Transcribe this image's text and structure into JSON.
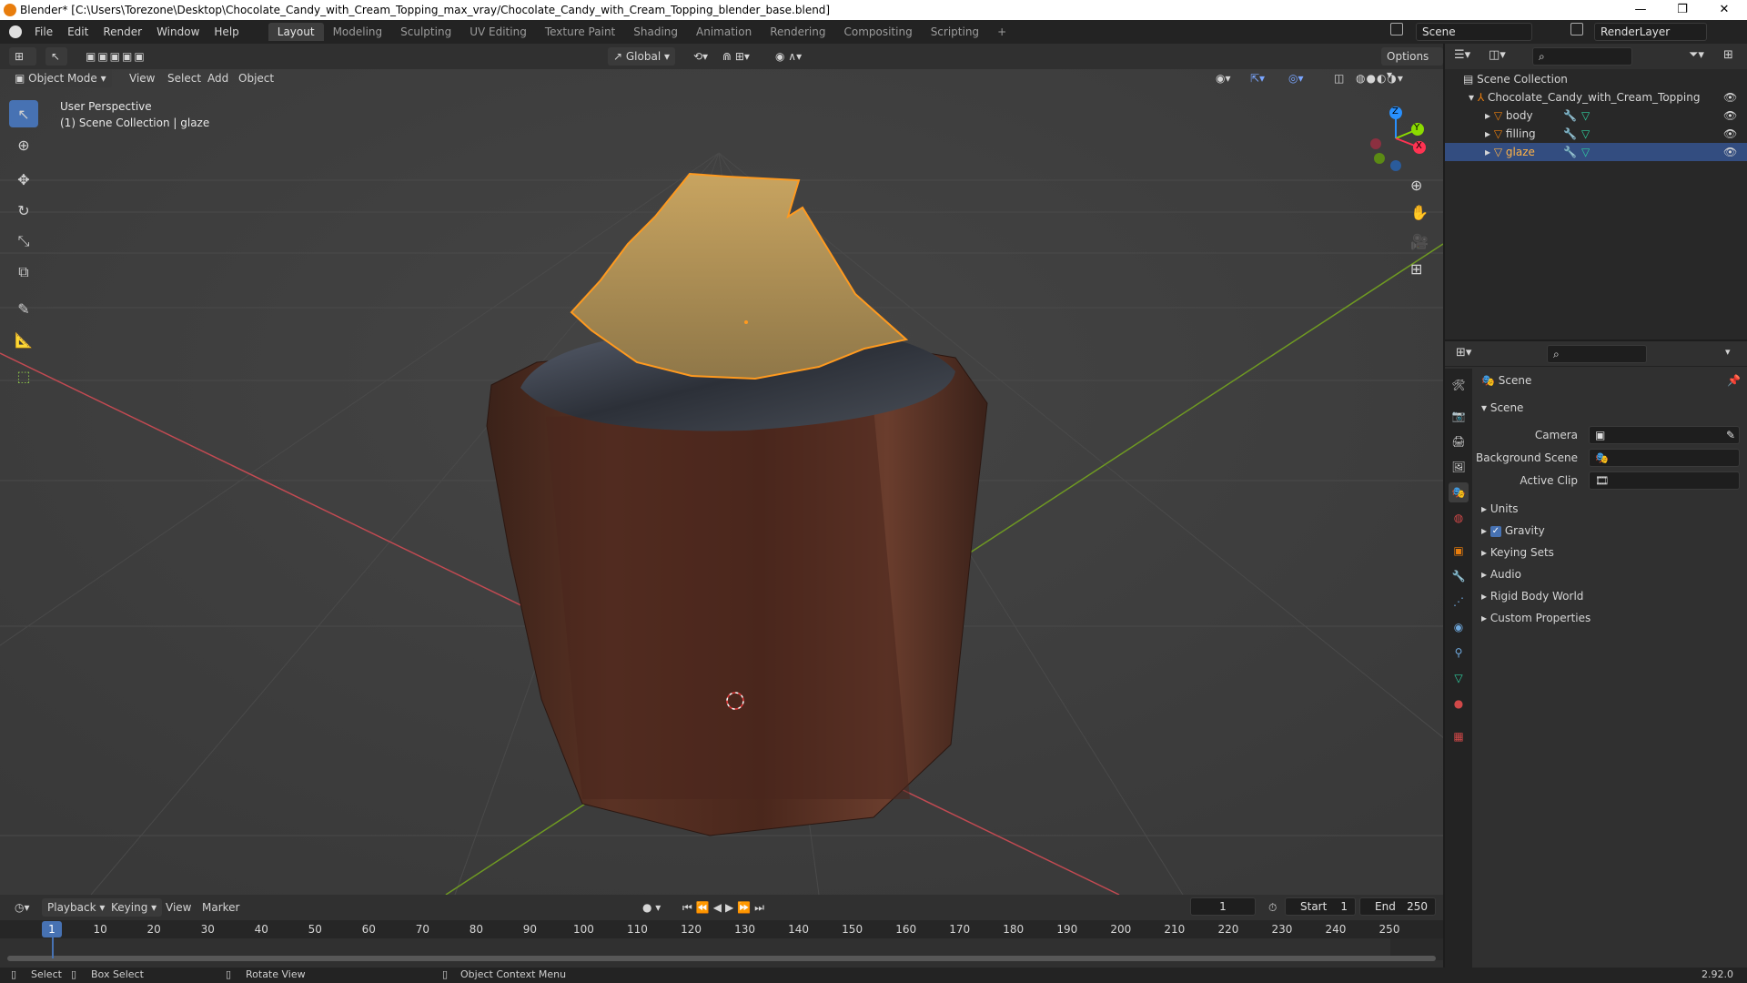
{
  "window": {
    "title": "Blender* [C:\\Users\\Torezone\\Desktop\\Chocolate_Candy_with_Cream_Topping_max_vray/Chocolate_Candy_with_Cream_Topping_blender_base.blend]",
    "minimize": "—",
    "maximize": "❐",
    "close": "✕"
  },
  "menu": [
    "File",
    "Edit",
    "Render",
    "Window",
    "Help"
  ],
  "workspaces": [
    "Layout",
    "Modeling",
    "Sculpting",
    "UV Editing",
    "Texture Paint",
    "Shading",
    "Animation",
    "Rendering",
    "Compositing",
    "Scripting"
  ],
  "add_workspace": "+",
  "scene_field": "Scene",
  "renderlayer_field": "RenderLayer",
  "viewport": {
    "transform_orientation": "Global",
    "options": "Options",
    "mode": "Object Mode",
    "menus": [
      "View",
      "Select",
      "Add",
      "Object"
    ],
    "overlay_line1": "User Perspective",
    "overlay_line2": "(1) Scene Collection | glaze",
    "gizmo": {
      "z": "Z",
      "y": "Y",
      "x": "X"
    }
  },
  "outliner": {
    "root": "Scene Collection",
    "collection": "Chocolate_Candy_with_Cream_Topping",
    "objects": [
      "body",
      "filling",
      "glaze"
    ],
    "selected": "glaze"
  },
  "properties": {
    "context": "Scene",
    "panel": "Scene",
    "fields": [
      {
        "label": "Camera"
      },
      {
        "label": "Background Scene"
      },
      {
        "label": "Active Clip"
      }
    ],
    "sections": [
      "Units",
      "Gravity",
      "Keying Sets",
      "Audio",
      "Rigid Body World",
      "Custom Properties"
    ],
    "gravity_checked": true
  },
  "timeline": {
    "menus": [
      "Playback",
      "Keying",
      "View",
      "Marker"
    ],
    "current_frame": "1",
    "start_label": "Start",
    "start": "1",
    "end_label": "End",
    "end": "250",
    "ticks": [
      "1",
      "10",
      "20",
      "30",
      "40",
      "50",
      "60",
      "70",
      "80",
      "90",
      "100",
      "110",
      "120",
      "130",
      "140",
      "150",
      "160",
      "170",
      "180",
      "190",
      "200",
      "210",
      "220",
      "230",
      "240",
      "250"
    ]
  },
  "statusbar": {
    "select": "Select",
    "box_select": "Box Select",
    "rotate_view": "Rotate View",
    "context_menu": "Object Context Menu",
    "version": "2.92.0"
  },
  "colors": {
    "accent": "#4772b3",
    "selection_outline": "#ff9a1f",
    "axis_x": "#ff3352",
    "axis_y": "#8bdc00",
    "axis_z": "#2890ff"
  }
}
